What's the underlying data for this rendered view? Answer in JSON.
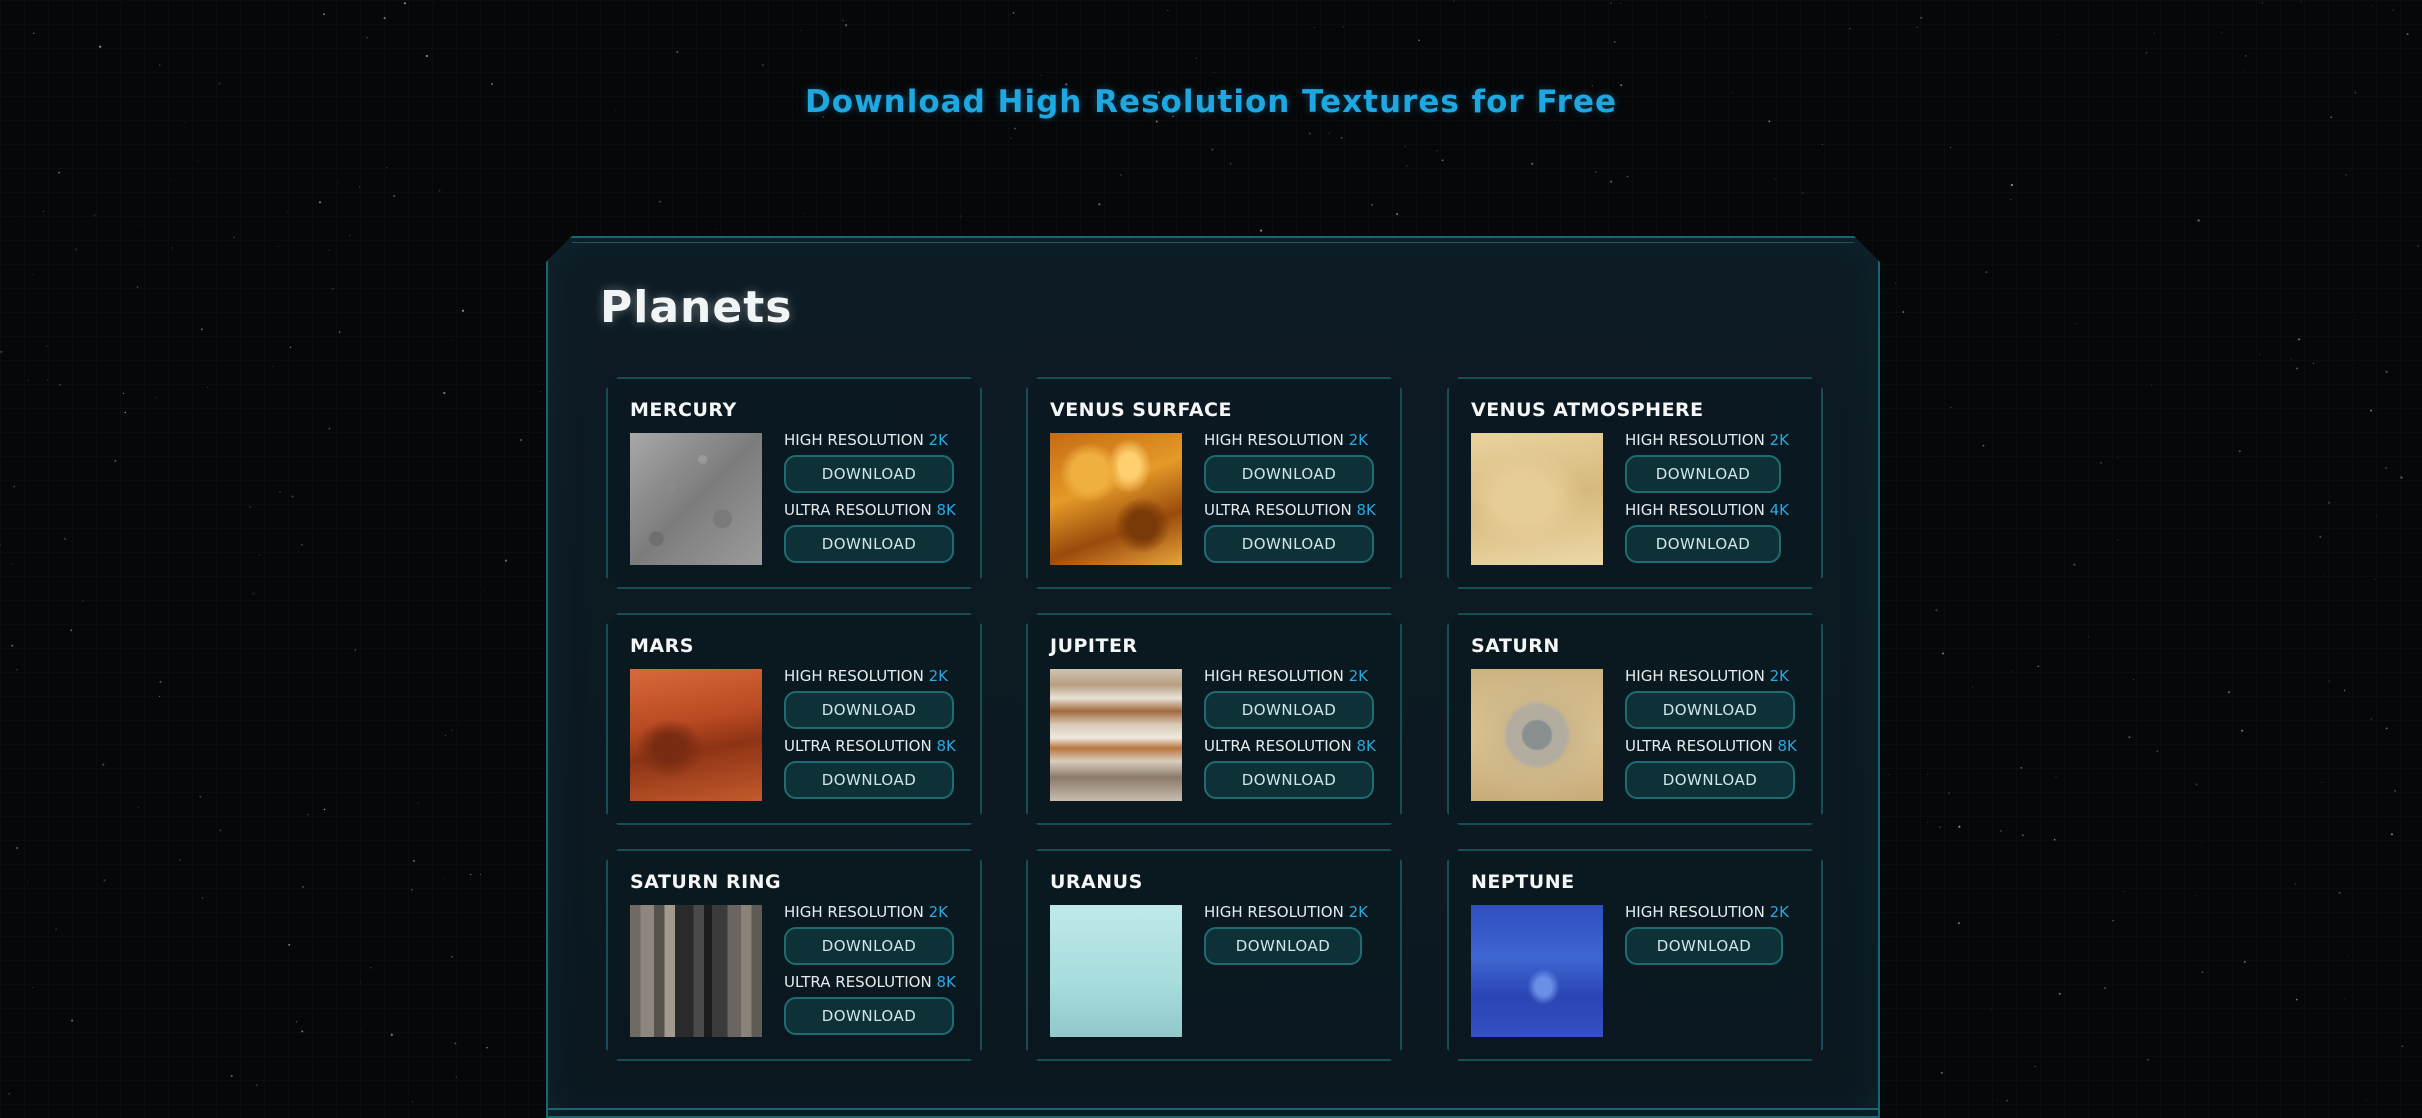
{
  "page": {
    "header": "Download High Resolution Textures for Free",
    "section_title": "Planets"
  },
  "colors": {
    "accent": "#1ea7e0",
    "panel_border": "#1a6670",
    "button_bg": "#0e3138"
  },
  "cards": [
    {
      "title": "MERCURY",
      "texture": "mercury-texture",
      "options": [
        {
          "label": "HIGH RESOLUTION",
          "value": "2K",
          "button": "DOWNLOAD"
        },
        {
          "label": "ULTRA RESOLUTION",
          "value": "8K",
          "button": "DOWNLOAD"
        }
      ]
    },
    {
      "title": "VENUS SURFACE",
      "texture": "venus-surface-texture",
      "options": [
        {
          "label": "HIGH RESOLUTION",
          "value": "2K",
          "button": "DOWNLOAD"
        },
        {
          "label": "ULTRA RESOLUTION",
          "value": "8K",
          "button": "DOWNLOAD"
        }
      ]
    },
    {
      "title": "VENUS ATMOSPHERE",
      "texture": "venus-atmosphere-texture",
      "options": [
        {
          "label": "HIGH RESOLUTION",
          "value": "2K",
          "button": "DOWNLOAD"
        },
        {
          "label": "HIGH RESOLUTION",
          "value": "4K",
          "button": "DOWNLOAD"
        }
      ]
    },
    {
      "title": "MARS",
      "texture": "mars-texture",
      "options": [
        {
          "label": "HIGH RESOLUTION",
          "value": "2K",
          "button": "DOWNLOAD"
        },
        {
          "label": "ULTRA RESOLUTION",
          "value": "8K",
          "button": "DOWNLOAD"
        }
      ]
    },
    {
      "title": "JUPITER",
      "texture": "jupiter-texture",
      "options": [
        {
          "label": "HIGH RESOLUTION",
          "value": "2K",
          "button": "DOWNLOAD"
        },
        {
          "label": "ULTRA RESOLUTION",
          "value": "8K",
          "button": "DOWNLOAD"
        }
      ]
    },
    {
      "title": "SATURN",
      "texture": "saturn-texture",
      "options": [
        {
          "label": "HIGH RESOLUTION",
          "value": "2K",
          "button": "DOWNLOAD"
        },
        {
          "label": "ULTRA RESOLUTION",
          "value": "8K",
          "button": "DOWNLOAD"
        }
      ]
    },
    {
      "title": "SATURN RING",
      "texture": "saturn-ring-texture",
      "options": [
        {
          "label": "HIGH RESOLUTION",
          "value": "2K",
          "button": "DOWNLOAD"
        },
        {
          "label": "ULTRA RESOLUTION",
          "value": "8K",
          "button": "DOWNLOAD"
        }
      ]
    },
    {
      "title": "URANUS",
      "texture": "uranus-texture",
      "options": [
        {
          "label": "HIGH RESOLUTION",
          "value": "2K",
          "button": "DOWNLOAD"
        }
      ]
    },
    {
      "title": "NEPTUNE",
      "texture": "neptune-texture",
      "options": [
        {
          "label": "HIGH RESOLUTION",
          "value": "2K",
          "button": "DOWNLOAD"
        }
      ]
    }
  ]
}
